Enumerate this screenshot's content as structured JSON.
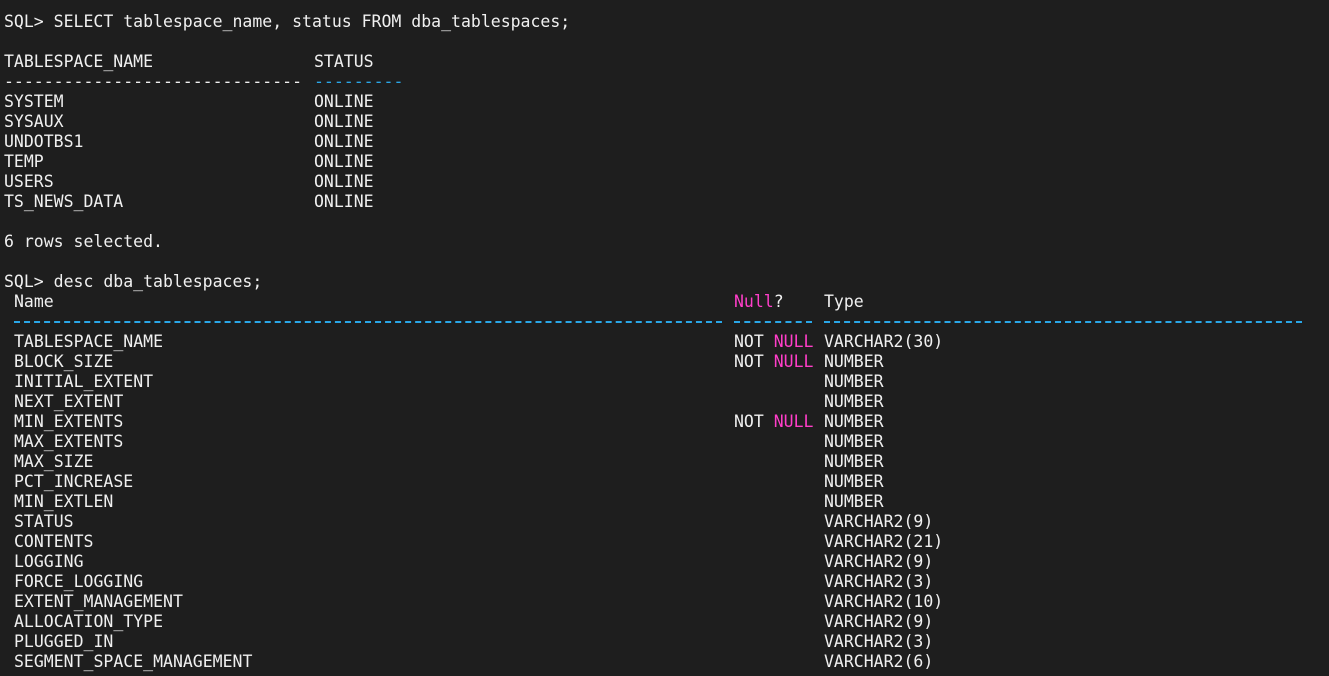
{
  "session": {
    "query1": "SQL> SELECT tablespace_name, status FROM dba_tablespaces;",
    "q1_headers": {
      "name": "TABLESPACE_NAME",
      "status": "STATUS"
    },
    "q1_dash_name": "------------------------------",
    "q1_dash_status": "---------",
    "q1_rows": [
      {
        "name": "SYSTEM",
        "status": "ONLINE"
      },
      {
        "name": "SYSAUX",
        "status": "ONLINE"
      },
      {
        "name": "UNDOTBS1",
        "status": "ONLINE"
      },
      {
        "name": "TEMP",
        "status": "ONLINE"
      },
      {
        "name": "USERS",
        "status": "ONLINE"
      },
      {
        "name": "TS_NEWS_DATA",
        "status": "ONLINE"
      }
    ],
    "q1_footer": "6 rows selected.",
    "query2": "SQL> desc dba_tablespaces;",
    "q2_headers": {
      "name": "Name",
      "null_word": "Null",
      "null_q": "?",
      "type": "Type"
    },
    "q2_rows": [
      {
        "name": "TABLESPACE_NAME",
        "not": "NOT ",
        "null": "NULL",
        "type": "VARCHAR2(30)"
      },
      {
        "name": "BLOCK_SIZE",
        "not": "NOT ",
        "null": "NULL",
        "type": "NUMBER"
      },
      {
        "name": "INITIAL_EXTENT",
        "not": "",
        "null": "",
        "type": "NUMBER"
      },
      {
        "name": "NEXT_EXTENT",
        "not": "",
        "null": "",
        "type": "NUMBER"
      },
      {
        "name": "MIN_EXTENTS",
        "not": "NOT ",
        "null": "NULL",
        "type": "NUMBER"
      },
      {
        "name": "MAX_EXTENTS",
        "not": "",
        "null": "",
        "type": "NUMBER"
      },
      {
        "name": "MAX_SIZE",
        "not": "",
        "null": "",
        "type": "NUMBER"
      },
      {
        "name": "PCT_INCREASE",
        "not": "",
        "null": "",
        "type": "NUMBER"
      },
      {
        "name": "MIN_EXTLEN",
        "not": "",
        "null": "",
        "type": "NUMBER"
      },
      {
        "name": "STATUS",
        "not": "",
        "null": "",
        "type": "VARCHAR2(9)"
      },
      {
        "name": "CONTENTS",
        "not": "",
        "null": "",
        "type": "VARCHAR2(21)"
      },
      {
        "name": "LOGGING",
        "not": "",
        "null": "",
        "type": "VARCHAR2(9)"
      },
      {
        "name": "FORCE_LOGGING",
        "not": "",
        "null": "",
        "type": "VARCHAR2(3)"
      },
      {
        "name": "EXTENT_MANAGEMENT",
        "not": "",
        "null": "",
        "type": "VARCHAR2(10)"
      },
      {
        "name": "ALLOCATION_TYPE",
        "not": "",
        "null": "",
        "type": "VARCHAR2(9)"
      },
      {
        "name": "PLUGGED_IN",
        "not": "",
        "null": "",
        "type": "VARCHAR2(3)"
      },
      {
        "name": "SEGMENT_SPACE_MANAGEMENT",
        "not": "",
        "null": "",
        "type": "VARCHAR2(6)"
      }
    ]
  },
  "colors": {
    "background": "#1e1e1e",
    "text": "#f0f0f0",
    "dash_cyan": "#2aa7e8",
    "keyword_magenta": "#ff3ec9"
  }
}
